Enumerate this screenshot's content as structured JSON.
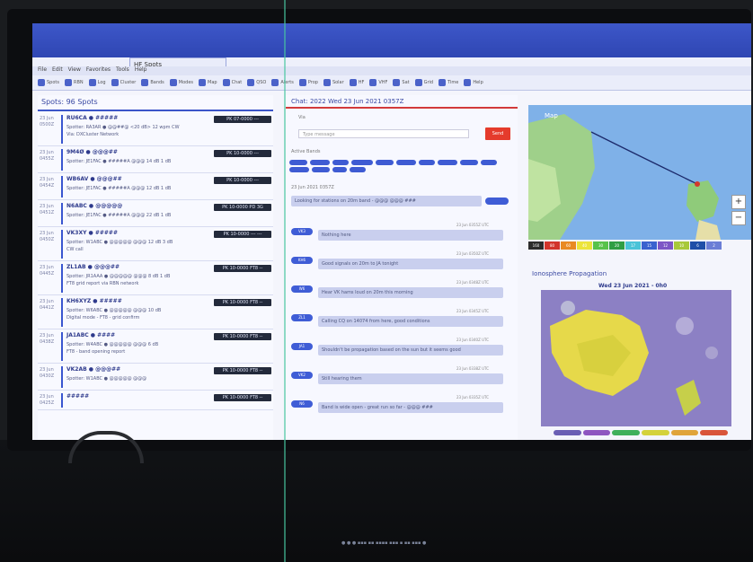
{
  "window": {
    "tab_title": "HF Spots"
  },
  "menubar": [
    "File",
    "Edit",
    "View",
    "Favorites",
    "Tools",
    "Help"
  ],
  "toolbar": [
    "Spots",
    "RBN",
    "Log",
    "Cluster",
    "Bands",
    "Modes",
    "Map",
    "Chat",
    "QSO",
    "Alerts",
    "Prop",
    "Solar",
    "HF",
    "VHF",
    "Sat",
    "Grid",
    "Time",
    "Help"
  ],
  "spots_panel": {
    "title": "Spots: 96 Spots",
    "items": [
      {
        "time": "23 Jun 0500Z",
        "name": "RU6CA ● #####",
        "lines": [
          "Spotter: RA3AR ● @@##@ <20 dB> 12 wpm CW",
          "Via: DXCluster Network"
        ],
        "ref": "PK 07-0000 ---"
      },
      {
        "time": "23 Jun 0455Z",
        "name": "9M4Ø ● @@@##",
        "lines": [
          "Spotter: JE1FAC ● #####A @@@ 14 dB 1 dB"
        ],
        "ref": "PK 10-0000 ---"
      },
      {
        "time": "23 Jun 0454Z",
        "name": "WB6AV ● @@@##",
        "lines": [
          "Spotter: JE1FAC ● #####A @@@ 12 dB 1 dB"
        ],
        "ref": "PK 10-0000 ---"
      },
      {
        "time": "23 Jun 0451Z",
        "name": "N6ABC ● @@@@@",
        "lines": [
          "Spotter: JE1FAC ● #####A @@@ 22 dB 1 dB"
        ],
        "ref": "PK 10-0000 PD 3G"
      },
      {
        "time": "23 Jun 0450Z",
        "name": "VK3XY ● #####",
        "lines": [
          "Spotter: W1ABC ● @@@@@ @@@ 12 dB 3 dB",
          "CW call"
        ],
        "ref": "PK 10-0000 --- ---"
      },
      {
        "time": "23 Jun 0445Z",
        "name": "ZL1AB ● @@@##",
        "lines": [
          "Spotter: JR1AAA ● @@@@@ @@@ 8 dB 1 dB",
          "FT8 grid report via RBN network"
        ],
        "ref": "PK 10-0000 FT8 --"
      },
      {
        "time": "23 Jun 0441Z",
        "name": "KH6XYZ ● #####",
        "lines": [
          "Spotter: W6ABC ● @@@@@ @@@ 10 dB",
          "Digital mode - FT8 - grid confirm"
        ],
        "ref": "PK 10-0000 FT8 --"
      },
      {
        "time": "23 Jun 0438Z",
        "name": "JA1ABC ● ####",
        "lines": [
          "Spotter: W4ABC ● @@@@@ @@@ 6 dB",
          "FT8 - band opening report"
        ],
        "ref": "PK 10-0000 FT8 --"
      },
      {
        "time": "23 Jun 0430Z",
        "name": "VK2AB ● @@@##",
        "lines": [
          "Spotter: W1ABC ● @@@@@ @@@"
        ],
        "ref": "PK 10-0000 FT8 --"
      },
      {
        "time": "23 Jun 0425Z",
        "name": "#####",
        "lines": [],
        "ref": "PK 10-0000 FT8 --"
      }
    ]
  },
  "chat_panel": {
    "header": "Chat: 2022 Wed 23 Jun 2021 0357Z",
    "field_label": "Via",
    "input_placeholder": "Type message",
    "send_label": "Send",
    "tags_label": "Active Bands",
    "status_line": "23 Jun 2021 0357Z",
    "first_message": "Looking for stations on 20m band - @@@ @@@ ###",
    "messages": [
      {
        "user": "VK3",
        "meta": "23 Jun 0355Z UTC",
        "text": "Nothing here"
      },
      {
        "user": "KH6",
        "meta": "23 Jun 0350Z UTC",
        "text": "Good signals on 20m to JA tonight"
      },
      {
        "user": "W6",
        "meta": "23 Jun 0348Z UTC",
        "text": "Hear VK hams loud on 20m this morning"
      },
      {
        "user": "ZL1",
        "meta": "23 Jun 0345Z UTC",
        "text": "Calling CQ on 14074 from here, good conditions"
      },
      {
        "user": "JA1",
        "meta": "23 Jun 0340Z UTC",
        "text": "Shouldn't be propagation based on the sun but it seems good"
      },
      {
        "user": "VK2",
        "meta": "23 Jun 0338Z UTC",
        "text": "Still hearing them"
      },
      {
        "user": "N6",
        "meta": "23 Jun 0335Z UTC",
        "text": "Band is wide open - great run so far - @@@ ###"
      }
    ]
  },
  "map_panel": {
    "title": "Map"
  },
  "legend": [
    {
      "label": "160",
      "color": "#2c2c2c"
    },
    {
      "label": "80",
      "color": "#d2342c"
    },
    {
      "label": "60",
      "color": "#e98a22"
    },
    {
      "label": "40",
      "color": "#ece43b"
    },
    {
      "label": "30",
      "color": "#58c24a"
    },
    {
      "label": "20",
      "color": "#2f9e44"
    },
    {
      "label": "17",
      "color": "#4ac3d8"
    },
    {
      "label": "15",
      "color": "#3a62cf"
    },
    {
      "label": "12",
      "color": "#7d56c6"
    },
    {
      "label": "10",
      "color": "#a8c93a"
    },
    {
      "label": "6",
      "color": "#1f4fa8"
    },
    {
      "label": "2",
      "color": "#6b7ed6"
    }
  ],
  "propagation": {
    "title": "Ionosphere Propagation",
    "date": "Wed 23 Jun 2021 - 0h0"
  },
  "prop_legend_colors": [
    "#6a5fb4",
    "#8e56c0",
    "#3fb05b",
    "#d4d23b",
    "#e0a43a",
    "#d9553a"
  ],
  "console": "● ● ● ▪▪▪ ▪▪ ▪▪▪▪ ▪▪▪ ▪ ▪▪ ▪▪▪ ●"
}
